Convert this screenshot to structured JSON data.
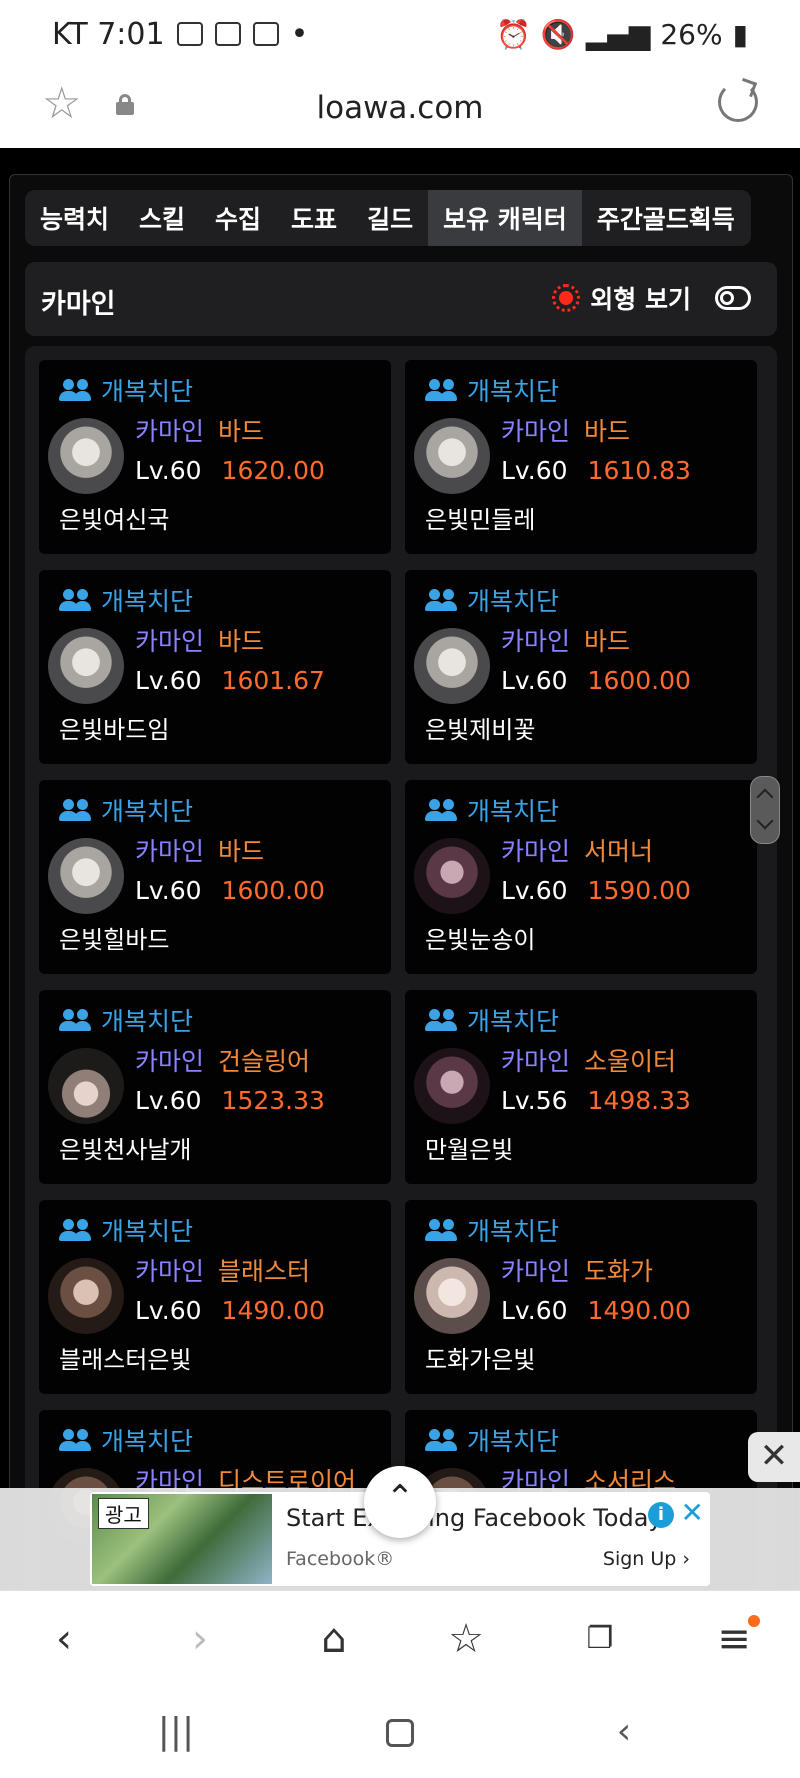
{
  "status": {
    "carrier_time": "KT 7:01",
    "battery": "26%"
  },
  "browser": {
    "url": "loawa.com"
  },
  "tabs": [
    "능력치",
    "스킬",
    "수집",
    "도표",
    "길드",
    "보유 캐릭터",
    "주간골드획득"
  ],
  "active_tab": "보유 캐릭터",
  "header": {
    "server": "카마인",
    "look_label": "외형 보기"
  },
  "characters": [
    {
      "guild": "개복치단",
      "server": "카마인",
      "job": "바드",
      "level": "Lv.60",
      "item_level": "1620.00",
      "name": "은빛여신국"
    },
    {
      "guild": "개복치단",
      "server": "카마인",
      "job": "바드",
      "level": "Lv.60",
      "item_level": "1610.83",
      "name": "은빛민들레"
    },
    {
      "guild": "개복치단",
      "server": "카마인",
      "job": "바드",
      "level": "Lv.60",
      "item_level": "1601.67",
      "name": "은빛바드임"
    },
    {
      "guild": "개복치단",
      "server": "카마인",
      "job": "바드",
      "level": "Lv.60",
      "item_level": "1600.00",
      "name": "은빛제비꽃"
    },
    {
      "guild": "개복치단",
      "server": "카마인",
      "job": "바드",
      "level": "Lv.60",
      "item_level": "1600.00",
      "name": "은빛힐바드"
    },
    {
      "guild": "개복치단",
      "server": "카마인",
      "job": "서머너",
      "level": "Lv.60",
      "item_level": "1590.00",
      "name": "은빛눈송이"
    },
    {
      "guild": "개복치단",
      "server": "카마인",
      "job": "건슬링어",
      "level": "Lv.60",
      "item_level": "1523.33",
      "name": "은빛천사날개"
    },
    {
      "guild": "개복치단",
      "server": "카마인",
      "job": "소울이터",
      "level": "Lv.56",
      "item_level": "1498.33",
      "name": "만월은빛"
    },
    {
      "guild": "개복치단",
      "server": "카마인",
      "job": "블래스터",
      "level": "Lv.60",
      "item_level": "1490.00",
      "name": "블래스터은빛"
    },
    {
      "guild": "개복치단",
      "server": "카마인",
      "job": "도화가",
      "level": "Lv.60",
      "item_level": "1490.00",
      "name": "도화가은빛"
    },
    {
      "guild": "개복치단",
      "server": "카마인",
      "job": "디스트로이어",
      "level": "",
      "item_level": "",
      "name": ""
    },
    {
      "guild": "개복치단",
      "server": "카마인",
      "job": "소서리스",
      "level": "",
      "item_level": "",
      "name": ""
    }
  ],
  "ad": {
    "label": "광고",
    "title": "Start Exploring Facebook Today",
    "source": "Facebook®",
    "cta": "Sign Up"
  },
  "colors": {
    "guild": "#3aa3e6",
    "server": "#8b82ff",
    "job": "#f08a3a",
    "item_level": "#ff6b2f"
  }
}
